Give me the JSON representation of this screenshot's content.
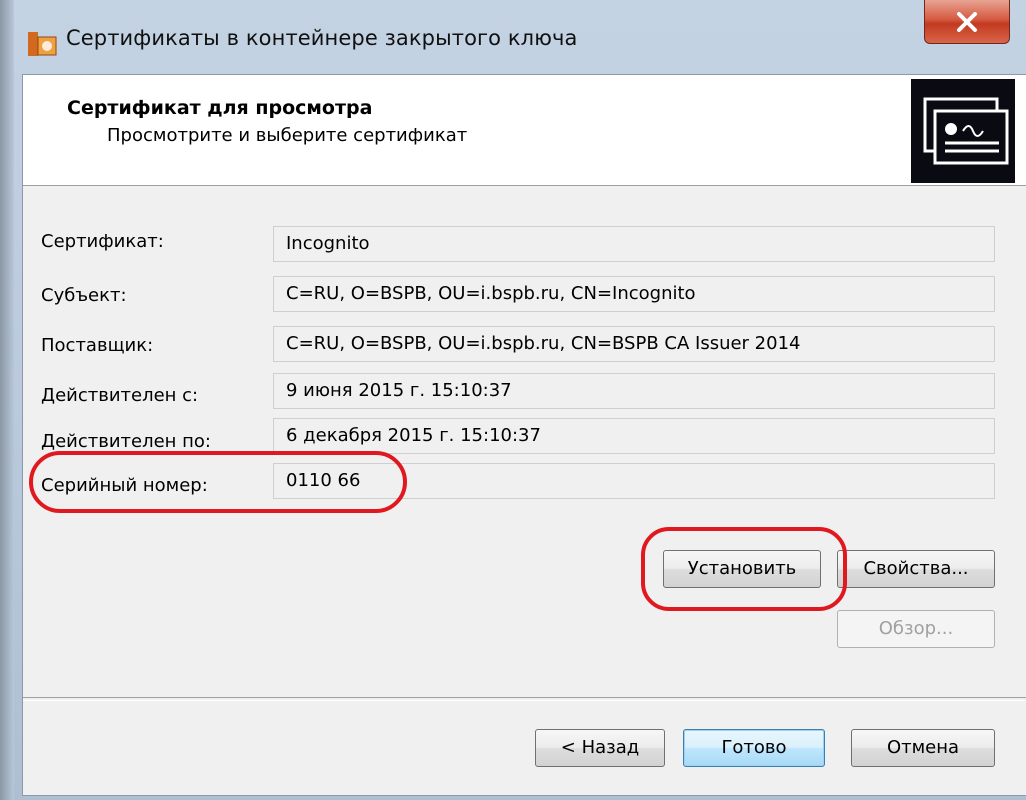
{
  "window": {
    "title": "Сертификаты в контейнере закрытого ключа",
    "close_label": "X"
  },
  "header": {
    "title": "Сертификат для просмотра",
    "subtitle": "Просмотрите и выберите сертификат",
    "icon": "certificate-icon"
  },
  "fields": [
    {
      "label": "Сертификат:",
      "value": "Incognito"
    },
    {
      "label": "Субъект:",
      "value": "C=RU, O=BSPB, OU=i.bspb.ru, CN=Incognito"
    },
    {
      "label": "Поставщик:",
      "value": "C=RU, O=BSPB, OU=i.bspb.ru, CN=BSPB CA Issuer 2014"
    },
    {
      "label": "Действителен с:",
      "value": "9 июня 2015 г. 15:10:37"
    },
    {
      "label": "Действителен по:",
      "value": "6 декабря 2015 г. 15:10:37"
    },
    {
      "label": "Серийный номер:",
      "value": "0110 66"
    }
  ],
  "buttons": {
    "install": "Установить",
    "properties": "Свойства...",
    "browse": "Обзор...",
    "back": "< Назад",
    "finish": "Готово",
    "cancel": "Отмена"
  },
  "colors": {
    "highlight": "#e0181f",
    "dialog_bg": "#f0f0f0"
  }
}
